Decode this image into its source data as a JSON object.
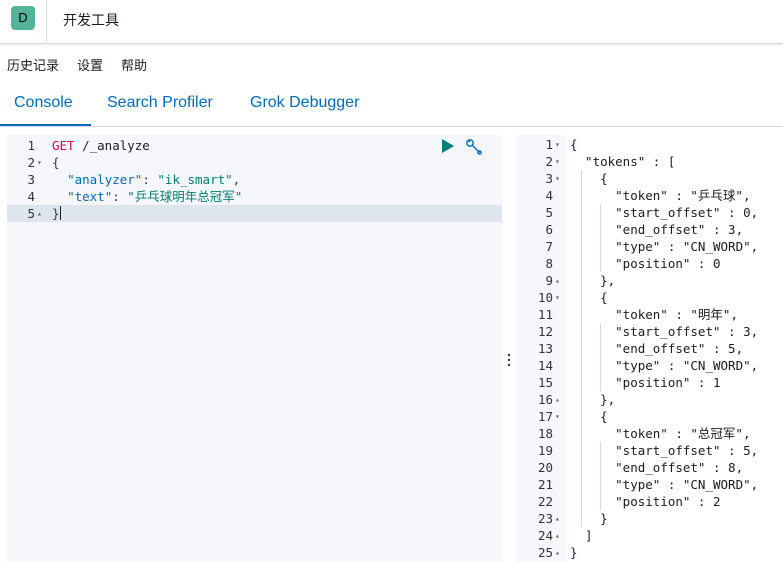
{
  "header": {
    "app_badge": "D",
    "app_title": "开发工具"
  },
  "menu": {
    "items": [
      "历史记录",
      "设置",
      "帮助"
    ]
  },
  "tabs": [
    "Console",
    "Search Profiler",
    "Grok Debugger"
  ],
  "active_tab": "Console",
  "request_editor": {
    "lines": [
      {
        "num": "1",
        "fold": "",
        "parts": [
          [
            "method",
            "GET"
          ],
          [
            "path",
            " /_analyze"
          ]
        ]
      },
      {
        "num": "2",
        "fold": "▾",
        "parts": [
          [
            "punc",
            "{"
          ]
        ]
      },
      {
        "num": "3",
        "fold": "",
        "parts": [
          [
            "punc",
            "  "
          ],
          [
            "key",
            "\"analyzer\""
          ],
          [
            "punc",
            ": "
          ],
          [
            "str",
            "\"ik_smart\""
          ],
          [
            "punc",
            ","
          ]
        ]
      },
      {
        "num": "4",
        "fold": "",
        "parts": [
          [
            "punc",
            "  "
          ],
          [
            "key",
            "\"text\""
          ],
          [
            "punc",
            ": "
          ],
          [
            "str",
            "\"乒乓球明年总冠军\""
          ]
        ]
      },
      {
        "num": "5",
        "fold": "▴",
        "parts": [
          [
            "punc",
            "}"
          ]
        ],
        "active": true
      }
    ]
  },
  "response_viewer": {
    "active_line": "20",
    "lines": [
      {
        "num": "1",
        "fold": "▾",
        "text": "{"
      },
      {
        "num": "2",
        "fold": "▾",
        "text": "  \"tokens\" : ["
      },
      {
        "num": "3",
        "fold": "▾",
        "text": "    {"
      },
      {
        "num": "4",
        "fold": "",
        "text": "      \"token\" : \"乒乓球\","
      },
      {
        "num": "5",
        "fold": "",
        "text": "      \"start_offset\" : 0,"
      },
      {
        "num": "6",
        "fold": "",
        "text": "      \"end_offset\" : 3,"
      },
      {
        "num": "7",
        "fold": "",
        "text": "      \"type\" : \"CN_WORD\","
      },
      {
        "num": "8",
        "fold": "",
        "text": "      \"position\" : 0"
      },
      {
        "num": "9",
        "fold": "▴",
        "text": "    },"
      },
      {
        "num": "10",
        "fold": "▾",
        "text": "    {"
      },
      {
        "num": "11",
        "fold": "",
        "text": "      \"token\" : \"明年\","
      },
      {
        "num": "12",
        "fold": "",
        "text": "      \"start_offset\" : 3,"
      },
      {
        "num": "13",
        "fold": "",
        "text": "      \"end_offset\" : 5,"
      },
      {
        "num": "14",
        "fold": "",
        "text": "      \"type\" : \"CN_WORD\","
      },
      {
        "num": "15",
        "fold": "",
        "text": "      \"position\" : 1"
      },
      {
        "num": "16",
        "fold": "▴",
        "text": "    },"
      },
      {
        "num": "17",
        "fold": "▾",
        "text": "    {"
      },
      {
        "num": "18",
        "fold": "",
        "text": "      \"token\" : \"总冠军\","
      },
      {
        "num": "19",
        "fold": "",
        "text": "      \"start_offset\" : 5,"
      },
      {
        "num": "20",
        "fold": "",
        "text": "      \"end_offset\" : 8,"
      },
      {
        "num": "21",
        "fold": "",
        "text": "      \"type\" : \"CN_WORD\","
      },
      {
        "num": "22",
        "fold": "",
        "text": "      \"position\" : 2"
      },
      {
        "num": "23",
        "fold": "▴",
        "text": "    }"
      },
      {
        "num": "24",
        "fold": "▴",
        "text": "  ]"
      },
      {
        "num": "25",
        "fold": "▴",
        "text": "}"
      }
    ]
  },
  "icons": {
    "run": "play-icon",
    "settings": "wrench-icon",
    "resize": "vertical-dots-icon"
  },
  "colors": {
    "accent": "#006bb4",
    "badge": "#54b399",
    "method": "#c80a68",
    "string": "#017d73",
    "run_icon": "#017d73"
  }
}
